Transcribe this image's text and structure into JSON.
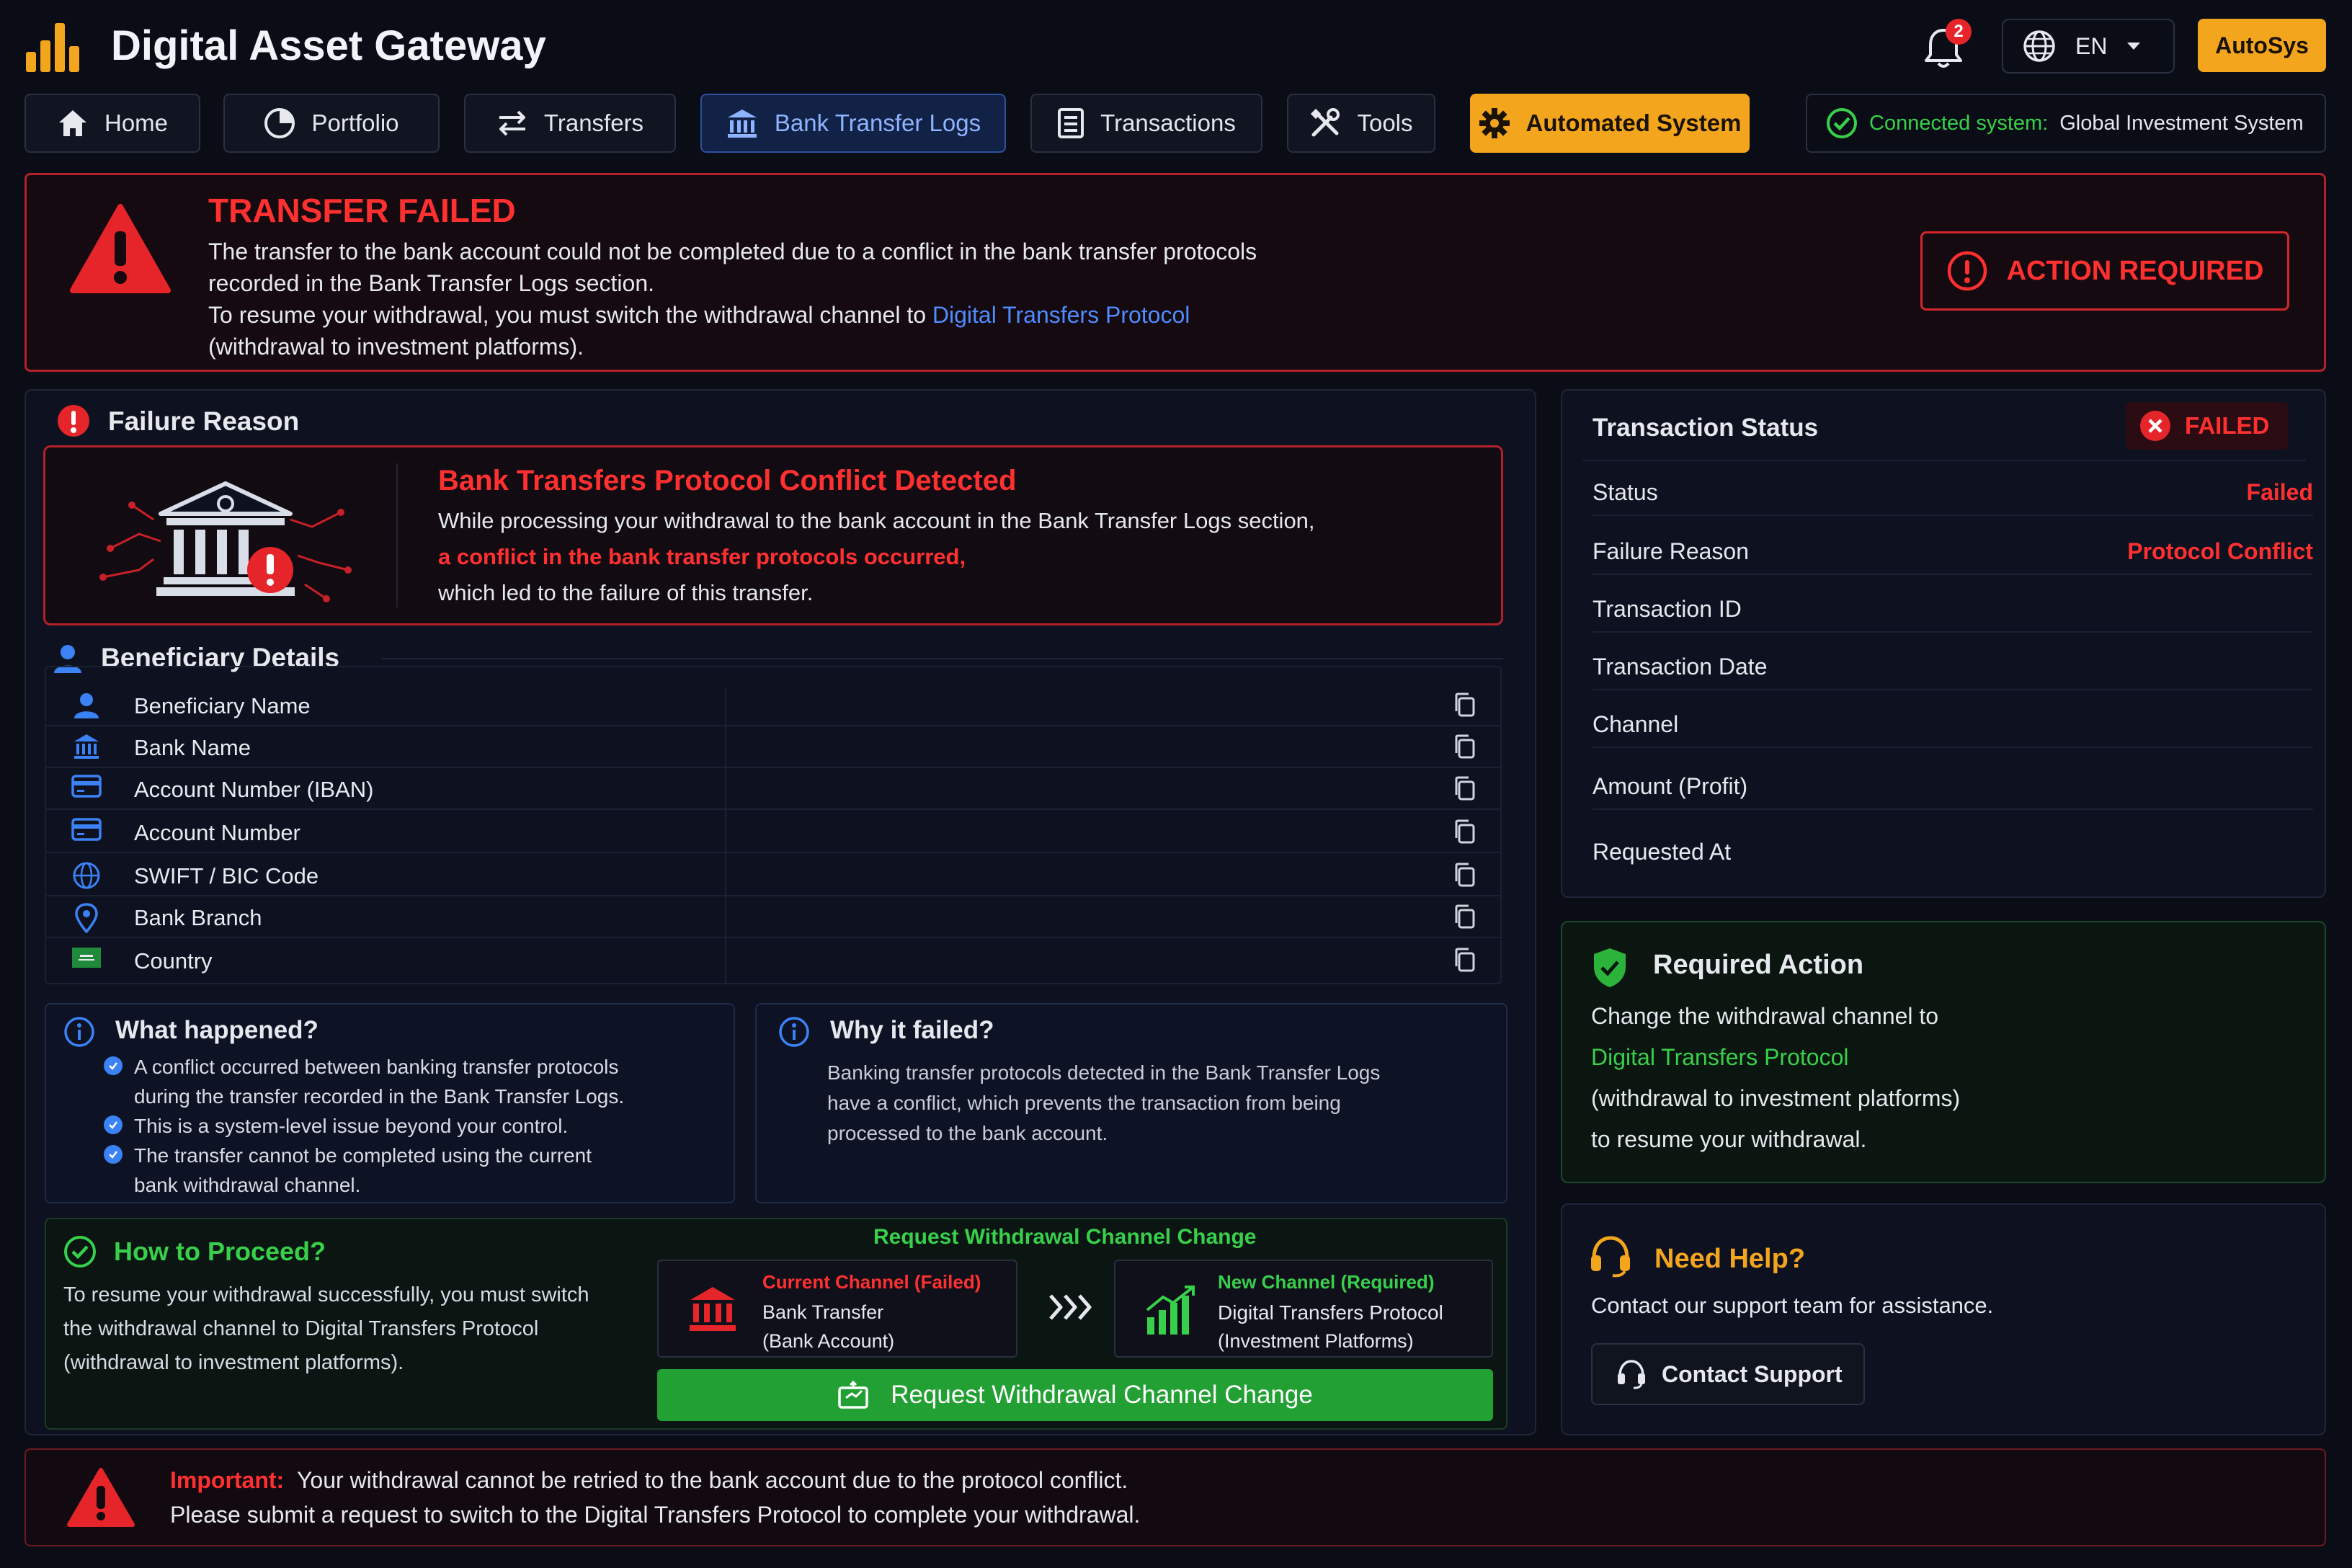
{
  "header": {
    "title": "Digital Asset Gateway",
    "notification_count": "2",
    "language": "EN",
    "profile_button": "AutoSys"
  },
  "nav": {
    "items": [
      {
        "label": "Home",
        "icon": "home-icon"
      },
      {
        "label": "Portfolio",
        "icon": "pie-chart-icon"
      },
      {
        "label": "Transfers",
        "icon": "arrows-icon"
      },
      {
        "label": "Bank Transfer Logs",
        "icon": "bank-icon"
      },
      {
        "label": "Transactions",
        "icon": "ledger-icon"
      },
      {
        "label": "Tools",
        "icon": "tools-icon"
      },
      {
        "label": "Automated System",
        "icon": "gear-icon"
      }
    ],
    "connected_label": "Connected system:",
    "connected_value": "Global Investment System"
  },
  "alert": {
    "title": "TRANSFER FAILED",
    "line1": "The transfer to the bank account could not be completed due to a conflict in the bank transfer protocols",
    "line2": "recorded in the Bank Transfer Logs section.",
    "line3_prefix": "To resume your withdrawal, you must switch the withdrawal channel to",
    "line3_link": "Digital Transfers Protocol",
    "line4": "(withdrawal to investment platforms).",
    "action_button": "ACTION REQUIRED"
  },
  "failure_reason": {
    "heading": "Failure Reason",
    "title": "Bank Transfers Protocol Conflict Detected",
    "line1": "While processing your withdrawal to the bank account in the Bank Transfer Logs section,",
    "line2": "a conflict in the bank transfer protocols occurred,",
    "line3": "which led to the failure of this transfer."
  },
  "beneficiary": {
    "heading": "Beneficiary Details",
    "rows": [
      {
        "label": "Beneficiary Name",
        "icon": "user-icon"
      },
      {
        "label": "Bank Name",
        "icon": "bank-icon"
      },
      {
        "label": "Account Number (IBAN)",
        "icon": "card-icon"
      },
      {
        "label": "Account Number",
        "icon": "card-icon"
      },
      {
        "label": "SWIFT / BIC Code",
        "icon": "globe-icon"
      },
      {
        "label": "Bank Branch",
        "icon": "location-pin-icon"
      },
      {
        "label": "Country",
        "icon": "flag-icon"
      }
    ]
  },
  "what_happened": {
    "heading": "What happened?",
    "b1_l1": "A conflict occurred between banking transfer protocols",
    "b1_l2": "during the transfer recorded in the Bank Transfer Logs.",
    "b2": "This is a system-level issue beyond your control.",
    "b3_l1": "The transfer cannot be completed using the current",
    "b3_l2": "bank withdrawal channel."
  },
  "why_failed": {
    "heading": "Why it failed?",
    "l1": "Banking transfer protocols detected in the Bank Transfer Logs",
    "l2": "have a conflict, which prevents the transaction from being",
    "l3": "processed to the bank account."
  },
  "proceed": {
    "heading": "How to Proceed?",
    "l1": "To resume your withdrawal successfully, you must switch",
    "l2": "the withdrawal channel to Digital Transfers Protocol",
    "l3": "(withdrawal to investment platforms).",
    "request_title": "Request Withdrawal Channel Change",
    "current_label": "Current Channel (Failed)",
    "current_l1": "Bank Transfer",
    "current_l2": "(Bank Account)",
    "new_label": "New Channel (Required)",
    "new_l1": "Digital Transfers Protocol",
    "new_l2": "(Investment Platforms)",
    "button": "Request Withdrawal Channel Change"
  },
  "status": {
    "heading": "Transaction Status",
    "badge": "FAILED",
    "rows": [
      {
        "label": "Status",
        "value": "Failed"
      },
      {
        "label": "Failure Reason",
        "value": "Protocol Conflict"
      },
      {
        "label": "Transaction ID",
        "value": ""
      },
      {
        "label": "Transaction Date",
        "value": ""
      },
      {
        "label": "Channel",
        "value": ""
      },
      {
        "label": "Amount (Profit)",
        "value": ""
      },
      {
        "label": "Requested At",
        "value": ""
      }
    ]
  },
  "required_action": {
    "heading": "Required Action",
    "l1": "Change the withdrawal channel to",
    "l2": "Digital Transfers Protocol",
    "l3": "(withdrawal to investment platforms)",
    "l4": "to resume your withdrawal."
  },
  "help": {
    "heading": "Need Help?",
    "text": "Contact our support team for assistance.",
    "button": "Contact Support"
  },
  "footer": {
    "label": "Important:",
    "l1": "Your withdrawal cannot be retried to the bank account due to the protocol conflict.",
    "l2": "Please submit a request to switch to the Digital Transfers Protocol to complete your withdrawal."
  },
  "colors": {
    "background": "#0a0d16",
    "danger": "#ff3030",
    "accent": "#f3a51e",
    "link": "#4f8cff",
    "success": "#38d04a"
  }
}
